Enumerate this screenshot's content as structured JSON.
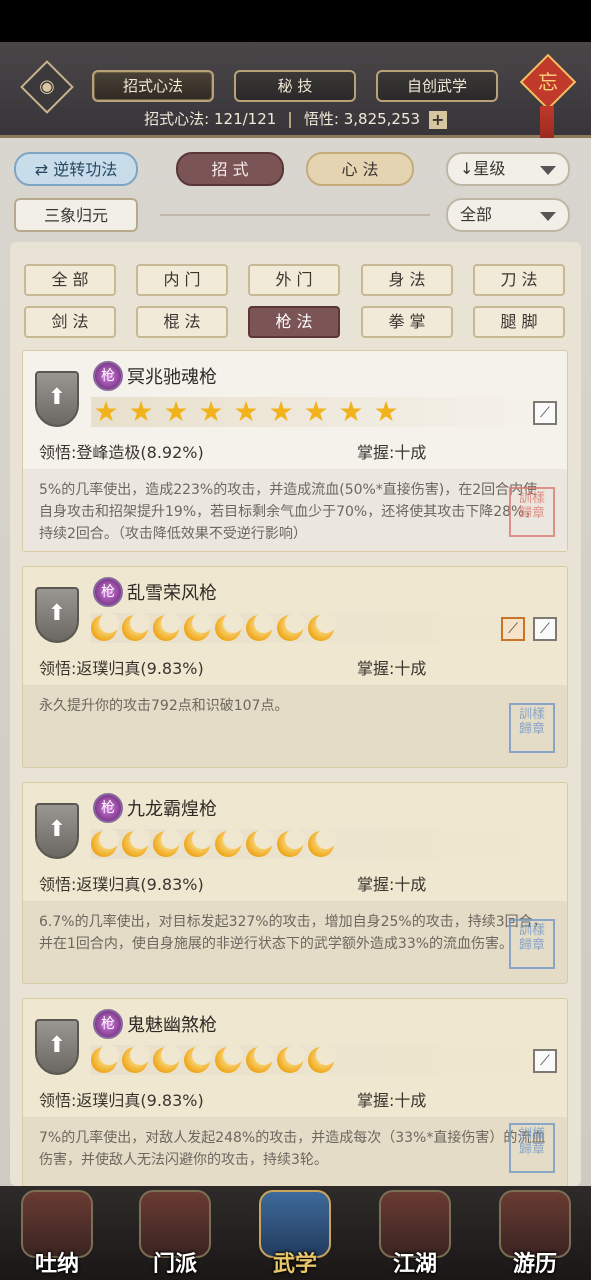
{
  "header": {
    "tabs": [
      "招式心法",
      "秘 技",
      "自创武学"
    ],
    "knot_label": "忘",
    "stats": {
      "moves_label": "招式心法:",
      "moves_value": "121/121",
      "insight_label": "悟性:",
      "insight_value": "3,825,253"
    }
  },
  "controls": {
    "reverse_button": "逆转功法",
    "category_tabs": [
      "招 式",
      "心 法"
    ],
    "sort_select": "星级",
    "secondary_button": "三象归元",
    "filter_select": "全部"
  },
  "filters": [
    "全 部",
    "内 门",
    "外 门",
    "身 法",
    "刀 法",
    "剑 法",
    "棍 法",
    "枪 法",
    "拳 掌",
    "腿 脚"
  ],
  "active_filter": "枪 法",
  "cards": [
    {
      "name": "冥兆驰魂枪",
      "gem": "枪",
      "rating_type": "star",
      "rating": 9,
      "comprehension_label": "领悟:",
      "comprehension": "登峰造极(8.92%)",
      "mastery_label": "掌握:",
      "mastery": "十成",
      "description": "5%的几率使出，造成223%的攻击，并造成流血(50%*直接伤害)，在2回合内使自身攻击和招架提升19%，若目标剩余气血少于70%，还将使其攻击下降28%，持续2回合。（攻击降低效果不受逆行影响）",
      "seal": "訓樣 歸章"
    },
    {
      "name": "乱雪荣风枪",
      "gem": "枪",
      "rating_type": "moon",
      "rating": 8,
      "comprehension_label": "领悟:",
      "comprehension": "返璞归真(9.83%)",
      "mastery_label": "掌握:",
      "mastery": "十成",
      "description": "永久提升你的攻击792点和识破107点。",
      "seal": "訓樣 歸章"
    },
    {
      "name": "九龙霸煌枪",
      "gem": "枪",
      "rating_type": "moon",
      "rating": 8,
      "comprehension_label": "领悟:",
      "comprehension": "返璞归真(9.83%)",
      "mastery_label": "掌握:",
      "mastery": "十成",
      "description": "6.7%的几率使出，对目标发起327%的攻击，增加自身25%的攻击，持续3回合，并在1回合内，使自身施展的非逆行状态下的武学额外造成33%的流血伤害。",
      "seal": "訓樣 歸章"
    },
    {
      "name": "鬼魅幽煞枪",
      "gem": "枪",
      "rating_type": "moon",
      "rating": 8,
      "comprehension_label": "领悟:",
      "comprehension": "返璞归真(9.83%)",
      "mastery_label": "掌握:",
      "mastery": "十成",
      "description": "7%的几率使出，对敌人发起248%的攻击，并造成每次（33%*直接伤害）的流血伤害，并使敌人无法闪避你的攻击，持续3轮。",
      "seal": "訓樣 歸章"
    }
  ],
  "bottom_nav": [
    "吐纳",
    "门派",
    "武学",
    "江湖",
    "游历"
  ],
  "active_nav": "武学",
  "colors": {
    "accent_red": "#7b5456",
    "star_gold": "#f2b21c",
    "active_nav": "#e8c56a"
  }
}
